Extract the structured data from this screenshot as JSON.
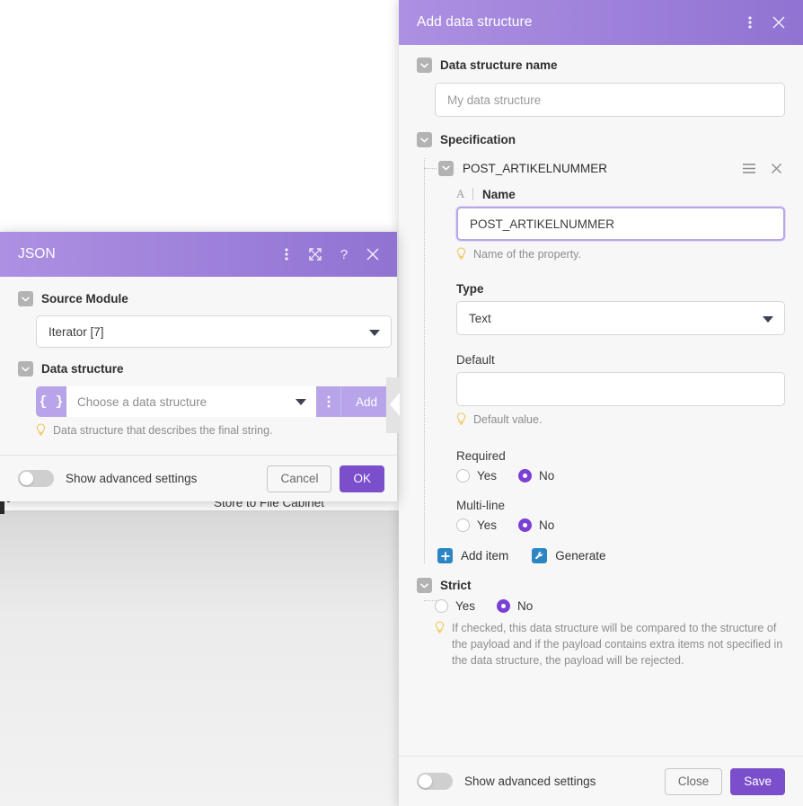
{
  "canvas": {
    "node_label": "Store to File Cabinet",
    "ghost_letter": "N"
  },
  "json_dialog": {
    "title": "JSON",
    "header_icons": {
      "kebab": "kebab-menu-icon",
      "expand": "expand-icon",
      "help": "?",
      "close": "close-icon"
    },
    "source_module": {
      "label": "Source Module",
      "value": "Iterator [7]"
    },
    "data_structure": {
      "label": "Data structure",
      "brace_icon": "{ }",
      "placeholder": "Choose a data structure",
      "add_label": "Add",
      "hint": "Data structure that describes the final string."
    },
    "footer": {
      "advanced_label": "Show advanced settings",
      "advanced_on": false,
      "cancel_label": "Cancel",
      "ok_label": "OK"
    }
  },
  "ds_panel": {
    "title": "Add data structure",
    "header_icons": {
      "kebab": "kebab-menu-icon",
      "close": "close-icon"
    },
    "name_section": {
      "label": "Data structure name",
      "value": "",
      "placeholder": "My data structure"
    },
    "specification": {
      "label": "Specification",
      "item": {
        "title": "POST_ARTIKELNUMMER",
        "drag_icon": "drag-handle-icon",
        "remove_icon": "remove-icon",
        "name_field": {
          "type_glyph": "A",
          "label": "Name",
          "value": "POST_ARTIKELNUMMER",
          "hint": "Name of the property."
        },
        "type_field": {
          "label": "Type",
          "value": "Text"
        },
        "default_field": {
          "label": "Default",
          "value": "",
          "hint": "Default value."
        },
        "required_field": {
          "label": "Required",
          "options": [
            "Yes",
            "No"
          ],
          "selected": "No"
        },
        "multiline_field": {
          "label": "Multi-line",
          "options": [
            "Yes",
            "No"
          ],
          "selected": "No"
        }
      },
      "actions": {
        "add_item_label": "Add item",
        "add_item_icon": "plus-icon",
        "generate_label": "Generate",
        "generate_icon": "wrench-icon"
      }
    },
    "strict": {
      "label": "Strict",
      "options": [
        "Yes",
        "No"
      ],
      "selected": "No",
      "hint": "If checked, this data structure will be compared to the structure of the payload and if the payload contains extra items not specified in the data structure, the payload will be rejected."
    },
    "footer": {
      "advanced_label": "Show advanced settings",
      "advanced_on": false,
      "close_label": "Close",
      "save_label": "Save"
    }
  },
  "colors": {
    "header_gradient_start": "#ad90e2",
    "header_gradient_end": "#9073d2",
    "primary_button": "#7b4ecb",
    "radio_selected": "#7b3fd4",
    "accent_blue": "#2c86c4",
    "panel_bg": "#f7f7f7"
  }
}
